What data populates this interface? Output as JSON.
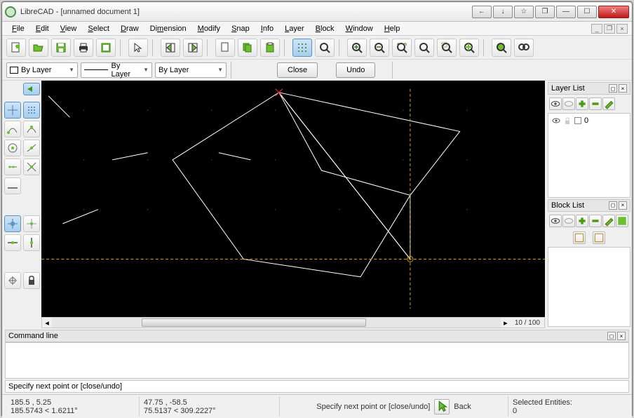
{
  "title": "LibreCAD - [unnamed document 1]",
  "menus": [
    "File",
    "Edit",
    "View",
    "Select",
    "Draw",
    "Dimension",
    "Modify",
    "Snap",
    "Info",
    "Layer",
    "Block",
    "Window",
    "Help"
  ],
  "props": {
    "color": "By Layer",
    "linetype": "By Layer",
    "lineweight": "By Layer",
    "close_btn": "Close",
    "undo_btn": "Undo"
  },
  "zoom_label": "10 / 100",
  "layer_panel": {
    "title": "Layer List",
    "layers": [
      {
        "name": "0"
      }
    ]
  },
  "block_panel": {
    "title": "Block List"
  },
  "command": {
    "title": "Command line",
    "prompt": "Specify next point or  [close/undo]"
  },
  "status": {
    "coord1a": "185.5 , 5.25",
    "coord1b": "185.5743 < 1.6211°",
    "coord2a": "47.75 , -58.5",
    "coord2b": "75.5137 < 309.2227°",
    "prompt": "Specify next point or [close/undo]",
    "back": "Back",
    "sel_label": "Selected Entities:",
    "sel_count": "0"
  }
}
